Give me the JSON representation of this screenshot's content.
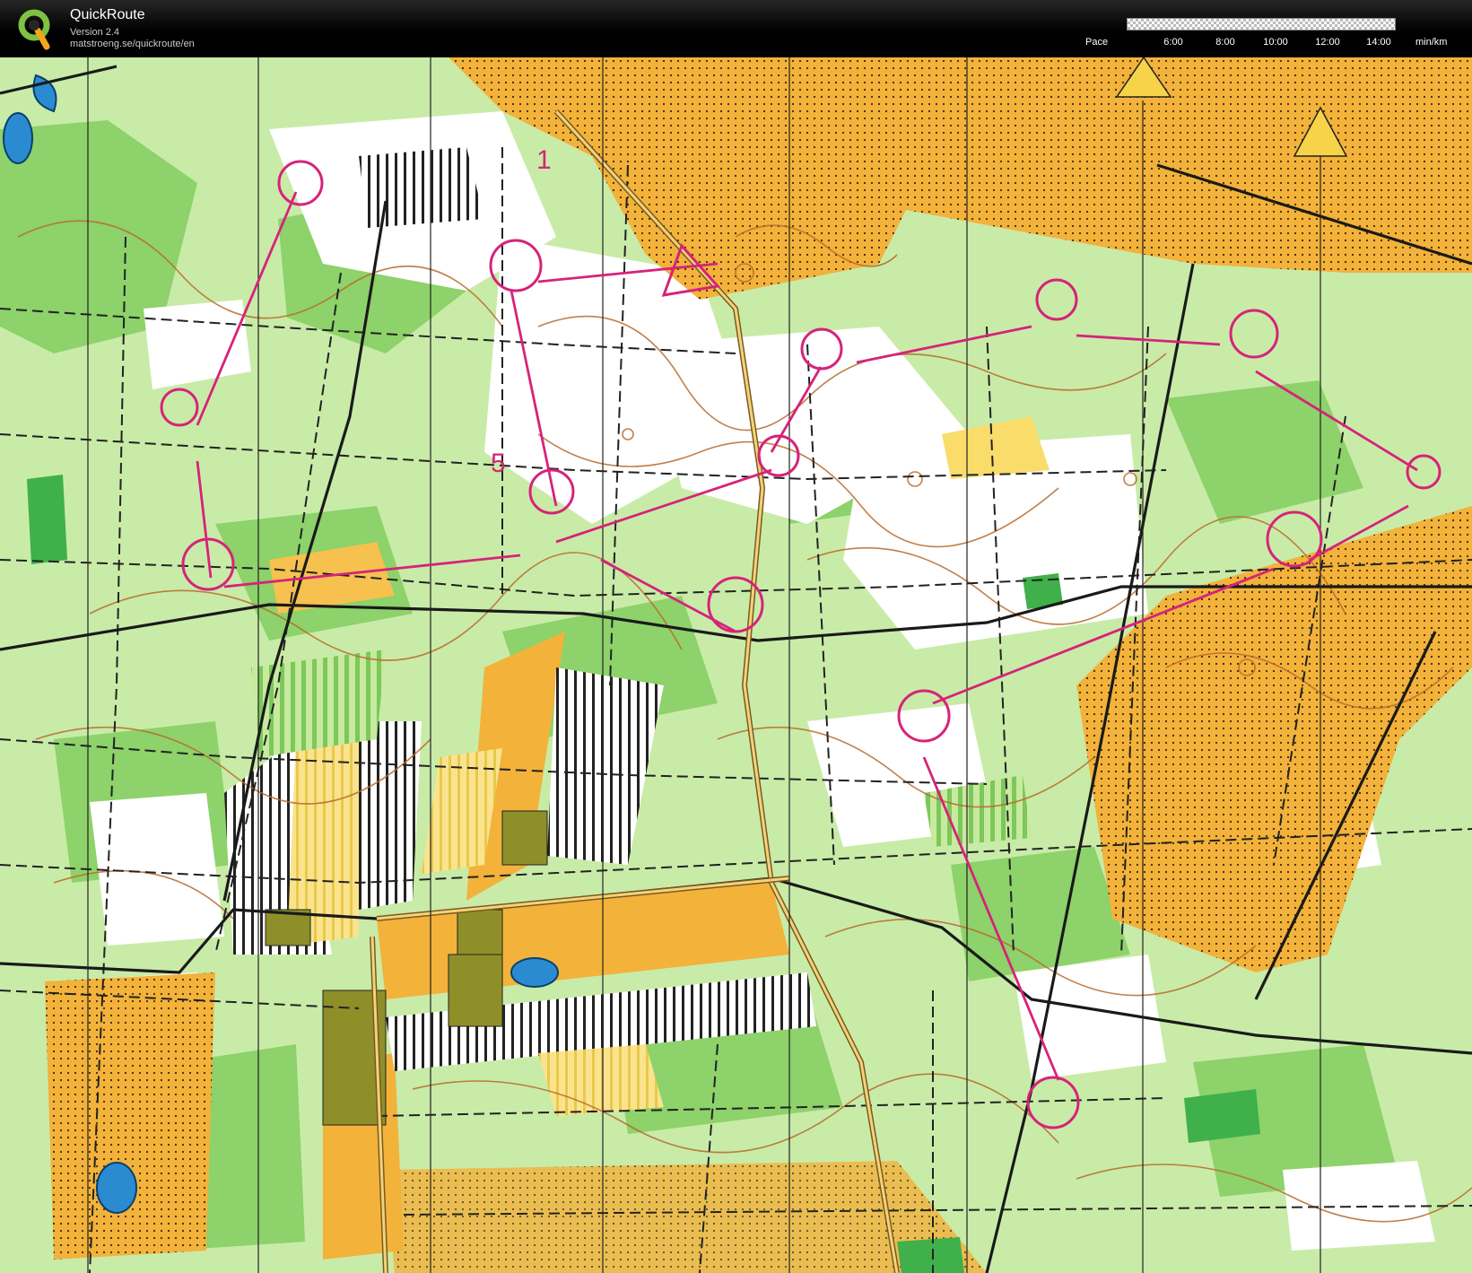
{
  "app": {
    "name": "QuickRoute",
    "version": "Version 2.4",
    "url": "matstroeng.se/quickroute/en"
  },
  "pace_scale": {
    "label": "Pace",
    "ticks": [
      "6:00",
      "8:00",
      "10:00",
      "12:00",
      "14:00"
    ],
    "unit": "min/km"
  },
  "map": {
    "type": "orienteering map",
    "control_numbers": [
      "1",
      "5"
    ],
    "colors": {
      "open_land": "#f3b23a",
      "rough_open": "#fbe38e",
      "forest_light": "#b9e29a",
      "forest_medium": "#7cc85a",
      "forest_white": "#ffffff",
      "contours": "#b86a2a",
      "course": "#d6237a",
      "tracks": "#222222",
      "water": "#2a8bd0",
      "buildings": "#8f8f2a"
    }
  }
}
